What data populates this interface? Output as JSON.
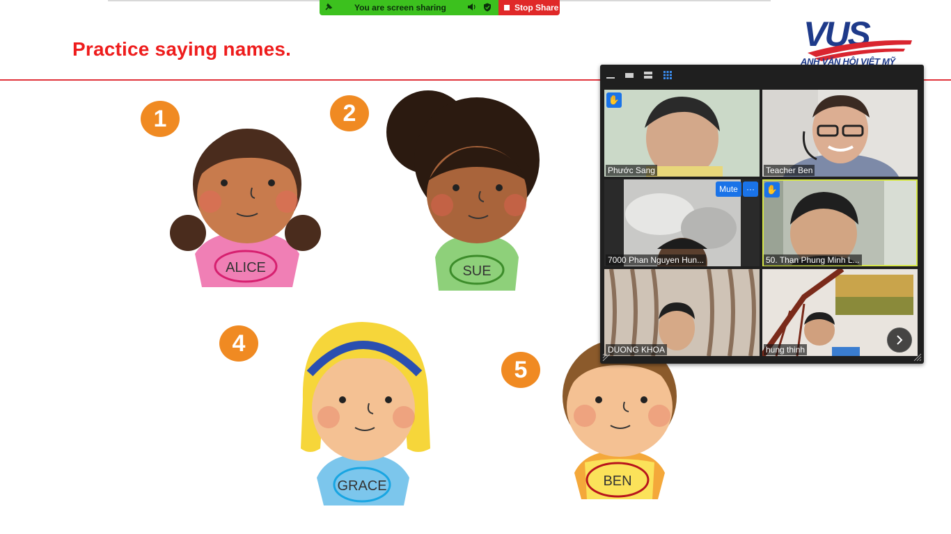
{
  "share_bar": {
    "message": "You are screen sharing",
    "stop_label": "Stop Share",
    "colors": {
      "bar": "#3cc11e",
      "stop": "#e02828"
    }
  },
  "slide": {
    "title": "Practice saying names.",
    "title_color": "#ee1c1c",
    "logo_text": "ANH VĂN HỘI VIỆT MỸ",
    "kids": [
      {
        "number": "1",
        "name": "ALICE"
      },
      {
        "number": "2",
        "name": "SUE"
      },
      {
        "number": "4",
        "name": "GRACE"
      },
      {
        "number": "5",
        "name": "BEN"
      }
    ]
  },
  "gallery": {
    "participants": [
      {
        "name": "Phước Sang",
        "hand_raised": true
      },
      {
        "name": "Teacher Ben",
        "hand_raised": false
      },
      {
        "name": "7000 Phan Nguyen Hun...",
        "hand_raised": false,
        "mute_label": "Mute",
        "more_label": "···"
      },
      {
        "name": "50. Than Phung Minh L...",
        "hand_raised": true,
        "active_speaker": true
      },
      {
        "name": "DUONG KHOA",
        "hand_raised": false
      },
      {
        "name": "hung thinh",
        "hand_raised": false
      }
    ],
    "icons": [
      "minimize-icon",
      "speaker-view-icon",
      "strip-view-icon",
      "gallery-view-icon",
      "next-page-icon"
    ]
  }
}
